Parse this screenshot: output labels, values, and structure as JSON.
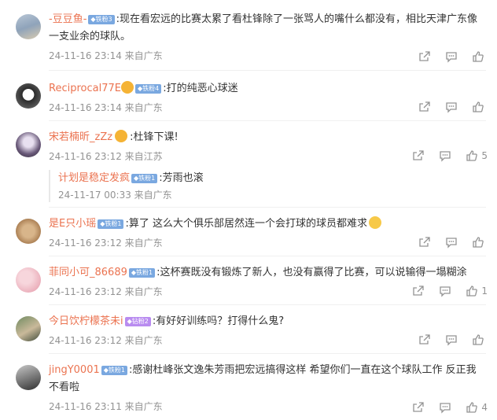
{
  "comments": [
    {
      "name": "-豆豆鱼-",
      "badge": "铁粉3",
      "text": ":现在看宏远的比赛太累了看杜锋除了一张骂人的嘴什么都没有，相比天津广东像",
      "text2": "一支业余的球队。",
      "meta": "24-11-16 23:14 来自广东",
      "likes": ""
    },
    {
      "name": "Reciprocal77E",
      "badge": "铁粉4",
      "text": ":打的纯恶心球迷",
      "meta": "24-11-16 23:14 来自广东",
      "likes": ""
    },
    {
      "name": "宋若楠昕_zZz",
      "text": ":杜锋下课!",
      "meta": "24-11-16 23:12 来自江苏",
      "likes": "5",
      "reply": {
        "name": "计划是稳定发疯",
        "badge": "铁粉1",
        "text": ":芳雨也滚",
        "meta": "24-11-17 00:33 来自广东"
      }
    },
    {
      "name": "是E只小瑶",
      "badge": "铁粉1",
      "text": ":算了 这么大个俱乐部居然连一个会打球的球员都难求",
      "meta": "24-11-16 23:12 来自广东",
      "likes": ""
    },
    {
      "name": "菲同小可_86689",
      "badge": "铁粉1",
      "text": ":这杯赛既没有锻炼了新人，也没有赢得了比赛，可以说输得一塌糊涂",
      "meta": "24-11-16 23:12 来自广东",
      "likes": "1"
    },
    {
      "name": "今日饮柠檬茶未i",
      "badge": "钻粉2",
      "text": ":有好好训练吗？打得什么鬼?",
      "meta": "24-11-16 23:12 来自广东",
      "likes": ""
    },
    {
      "name": "jingY0001",
      "badge": "铁粉1",
      "text": ":感谢杜峰张文逸朱芳雨把宏远搞得这样  希望你们一直在这个球队工作 反正我",
      "text2": "不看啦",
      "meta": "24-11-16 23:11 来自广东",
      "likes": "4"
    }
  ],
  "colors": {
    "name": "#eb7350",
    "meta": "#939393",
    "badge": "#7aa8e0"
  },
  "icons": [
    "share-icon",
    "comment-icon",
    "like-icon"
  ]
}
